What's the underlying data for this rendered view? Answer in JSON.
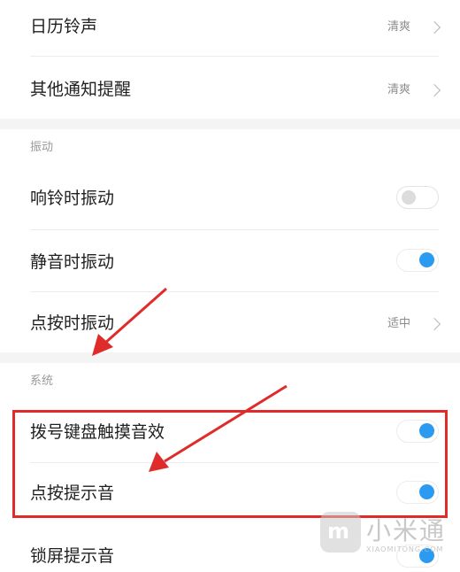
{
  "sound_section": {
    "items": [
      {
        "label": "日历铃声",
        "value": "清爽"
      },
      {
        "label": "其他通知提醒",
        "value": "清爽"
      }
    ]
  },
  "vibration_section": {
    "title": "振动",
    "items": [
      {
        "label": "响铃时振动",
        "toggle": "off"
      },
      {
        "label": "静音时振动",
        "toggle": "on"
      },
      {
        "label": "点按时振动",
        "value": "适中"
      }
    ]
  },
  "system_section": {
    "title": "系统",
    "items": [
      {
        "label": "拨号键盘触摸音效",
        "toggle": "on"
      },
      {
        "label": "点按提示音",
        "toggle": "on"
      },
      {
        "label": "锁屏提示音",
        "toggle": "on"
      }
    ]
  },
  "watermark": {
    "logo": "m",
    "name": "小米通",
    "url": "XIAOMITONG.COM"
  },
  "colors": {
    "toggle_on": "#2a9bf0",
    "annotation": "#e02b2b"
  }
}
